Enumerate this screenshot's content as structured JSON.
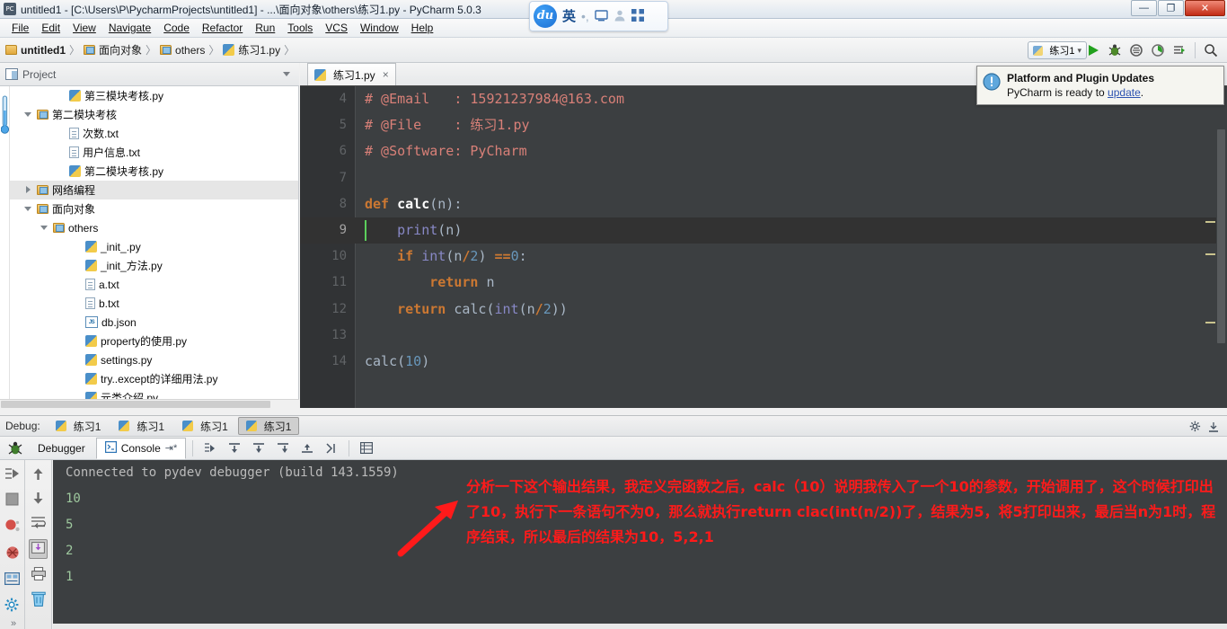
{
  "window": {
    "title": "untitled1 - [C:\\Users\\P\\PycharmProjects\\untitled1] - ...\\面向对象\\others\\练习1.py - PyCharm 5.0.3",
    "app_icon": "pycharm-icon",
    "minimize_label": "—",
    "maximize_label": "❐",
    "close_label": "✕"
  },
  "menu": {
    "items": [
      {
        "label": "File"
      },
      {
        "label": "Edit"
      },
      {
        "label": "View"
      },
      {
        "label": "Navigate"
      },
      {
        "label": "Code"
      },
      {
        "label": "Refactor"
      },
      {
        "label": "Run"
      },
      {
        "label": "Tools"
      },
      {
        "label": "VCS"
      },
      {
        "label": "Window"
      },
      {
        "label": "Help"
      }
    ]
  },
  "ime": {
    "logo": "du",
    "mode": "英",
    "punctuation": "•,",
    "keyboard_icon": "keyboard-icon",
    "user_icon": "user-icon",
    "apps_icon": "apps-grid-icon"
  },
  "breadcrumb": {
    "items": [
      {
        "label": "untitled1",
        "icon": "folder-icon",
        "bold": true
      },
      {
        "label": "面向对象",
        "icon": "module-folder-icon",
        "bold": false
      },
      {
        "label": "others",
        "icon": "module-folder-icon",
        "bold": false
      },
      {
        "label": "练习1.py",
        "icon": "python-file-icon",
        "bold": false
      }
    ],
    "separator": "〉"
  },
  "toolbar": {
    "run_config": "练习1",
    "run_config_caret": "▾",
    "buttons": [
      {
        "name": "run-button",
        "glyph": "▶"
      },
      {
        "name": "debug-button",
        "glyph": "🐞"
      },
      {
        "name": "coverage-button",
        "glyph": "◉"
      },
      {
        "name": "profile-button",
        "glyph": "◔"
      },
      {
        "name": "attach-button",
        "glyph": "☰"
      },
      {
        "name": "search-button",
        "glyph": "🔍"
      }
    ]
  },
  "project_panel": {
    "title": "Project",
    "caret": "▾",
    "tools": [
      {
        "name": "collapse-all-icon",
        "glyph": "⊖"
      },
      {
        "name": "expand-all-icon",
        "glyph": "÷"
      },
      {
        "name": "settings-icon",
        "glyph": "⚙"
      },
      {
        "name": "hide-panel-icon",
        "glyph": "⇥"
      }
    ],
    "tree": [
      {
        "label": "第三模块考核.py",
        "indent": 3,
        "icon": "python-file-icon",
        "twisty": "none",
        "selected": false
      },
      {
        "label": "第二模块考核",
        "indent": 1,
        "icon": "module-folder-icon",
        "twisty": "open",
        "selected": false
      },
      {
        "label": "次数.txt",
        "indent": 3,
        "icon": "text-file-icon",
        "twisty": "none",
        "selected": false
      },
      {
        "label": "用户信息.txt",
        "indent": 3,
        "icon": "text-file-icon",
        "twisty": "none",
        "selected": false
      },
      {
        "label": "第二模块考核.py",
        "indent": 3,
        "icon": "python-file-icon",
        "twisty": "none",
        "selected": false
      },
      {
        "label": "网络编程",
        "indent": 1,
        "icon": "module-folder-icon",
        "twisty": "closed",
        "selected": true
      },
      {
        "label": "面向对象",
        "indent": 1,
        "icon": "module-folder-icon",
        "twisty": "open",
        "selected": false
      },
      {
        "label": "others",
        "indent": 2,
        "icon": "module-folder-icon",
        "twisty": "open",
        "selected": false
      },
      {
        "label": "_init_.py",
        "indent": 4,
        "icon": "python-file-icon",
        "twisty": "none",
        "selected": false
      },
      {
        "label": "_init_方法.py",
        "indent": 4,
        "icon": "python-file-icon",
        "twisty": "none",
        "selected": false
      },
      {
        "label": "a.txt",
        "indent": 4,
        "icon": "text-file-icon",
        "twisty": "none",
        "selected": false
      },
      {
        "label": "b.txt",
        "indent": 4,
        "icon": "text-file-icon",
        "twisty": "none",
        "selected": false
      },
      {
        "label": "db.json",
        "indent": 4,
        "icon": "json-file-icon",
        "twisty": "none",
        "selected": false
      },
      {
        "label": "property的使用.py",
        "indent": 4,
        "icon": "python-file-icon",
        "twisty": "none",
        "selected": false
      },
      {
        "label": "settings.py",
        "indent": 4,
        "icon": "python-file-icon",
        "twisty": "none",
        "selected": false
      },
      {
        "label": "try..except的详细用法.py",
        "indent": 4,
        "icon": "python-file-icon",
        "twisty": "none",
        "selected": false
      },
      {
        "label": "元类介绍.py",
        "indent": 4,
        "icon": "python-file-icon",
        "twisty": "none",
        "selected": false
      }
    ]
  },
  "editor": {
    "tab": {
      "label": "练习1.py",
      "close": "×",
      "icon": "python-file-icon"
    },
    "lines": [
      {
        "num": "4",
        "current": false,
        "tokens": [
          {
            "t": "# @Email   : 15921237984@163.com",
            "c": "tok-com"
          }
        ]
      },
      {
        "num": "5",
        "current": false,
        "tokens": [
          {
            "t": "# @File    : 练习1.py",
            "c": "tok-com"
          }
        ]
      },
      {
        "num": "6",
        "current": false,
        "tokens": [
          {
            "t": "# @Software: PyCharm",
            "c": "tok-com"
          }
        ]
      },
      {
        "num": "7",
        "current": false,
        "tokens": []
      },
      {
        "num": "8",
        "current": false,
        "tokens": [
          {
            "t": "def ",
            "c": "tok-kw"
          },
          {
            "t": "calc",
            "c": "tok-fn"
          },
          {
            "t": "(n):",
            "c": "tok-pl"
          }
        ]
      },
      {
        "num": "9",
        "current": true,
        "tokens": [
          {
            "t": "    ",
            "c": "tok-pl"
          },
          {
            "t": "print",
            "c": "tok-bi"
          },
          {
            "t": "(n)",
            "c": "tok-pl"
          }
        ]
      },
      {
        "num": "10",
        "current": false,
        "tokens": [
          {
            "t": "    ",
            "c": "tok-pl"
          },
          {
            "t": "if ",
            "c": "tok-kw"
          },
          {
            "t": "int",
            "c": "tok-bi"
          },
          {
            "t": "(n",
            "c": "tok-pl"
          },
          {
            "t": "/",
            "c": "tok-kw"
          },
          {
            "t": "2",
            "c": "tok-num"
          },
          {
            "t": ") ",
            "c": "tok-pl"
          },
          {
            "t": "==",
            "c": "tok-kw"
          },
          {
            "t": "0",
            "c": "tok-num"
          },
          {
            "t": ":",
            "c": "tok-pl"
          }
        ]
      },
      {
        "num": "11",
        "current": false,
        "tokens": [
          {
            "t": "        ",
            "c": "tok-pl"
          },
          {
            "t": "return ",
            "c": "tok-kw"
          },
          {
            "t": "n",
            "c": "tok-pl"
          }
        ]
      },
      {
        "num": "12",
        "current": false,
        "tokens": [
          {
            "t": "    ",
            "c": "tok-pl"
          },
          {
            "t": "return ",
            "c": "tok-kw"
          },
          {
            "t": "calc(",
            "c": "tok-pl"
          },
          {
            "t": "int",
            "c": "tok-bi"
          },
          {
            "t": "(n",
            "c": "tok-pl"
          },
          {
            "t": "/",
            "c": "tok-kw"
          },
          {
            "t": "2",
            "c": "tok-num"
          },
          {
            "t": "))",
            "c": "tok-pl"
          }
        ]
      },
      {
        "num": "13",
        "current": false,
        "tokens": []
      },
      {
        "num": "14",
        "current": false,
        "tokens": [
          {
            "t": "calc(",
            "c": "tok-pl"
          },
          {
            "t": "10",
            "c": "tok-num"
          },
          {
            "t": ")",
            "c": "tok-pl"
          }
        ]
      }
    ]
  },
  "notification": {
    "icon": "info-icon",
    "title": "Platform and Plugin Updates",
    "body_prefix": "PyCharm is ready to ",
    "link": "update",
    "body_suffix": "."
  },
  "debug": {
    "label": "Debug:",
    "tabs": [
      {
        "label": "练习1",
        "active": false
      },
      {
        "label": "练习1",
        "active": false
      },
      {
        "label": "练习1",
        "active": false
      },
      {
        "label": "练习1",
        "active": true
      }
    ],
    "settings_icon": "gear-icon",
    "hide_icon": "hide-panel-icon",
    "subtabs": [
      {
        "label": "Debugger",
        "active": false,
        "icon": "debugger-icon"
      },
      {
        "label": "Console",
        "active": true,
        "icon": "console-icon"
      }
    ],
    "step_buttons": [
      {
        "name": "show-execution-point-icon",
        "glyph": "↳"
      },
      {
        "name": "step-over-icon",
        "glyph": "↓"
      },
      {
        "name": "step-into-icon",
        "glyph": "↘"
      },
      {
        "name": "force-step-into-icon",
        "glyph": "↙"
      },
      {
        "name": "step-out-icon",
        "glyph": "↗"
      },
      {
        "name": "run-to-cursor-icon",
        "glyph": "⇥"
      },
      {
        "name": "evaluate-expression-icon",
        "glyph": "▤"
      }
    ],
    "left_tools": [
      {
        "name": "resume-program-icon",
        "glyph": "▶"
      },
      {
        "name": "stop-program-icon",
        "glyph": "■"
      },
      {
        "name": "view-breakpoints-icon",
        "glyph": "●"
      },
      {
        "name": "mute-breakpoints-icon",
        "glyph": "⊘"
      },
      {
        "name": "restore-layout-icon",
        "glyph": "▣"
      },
      {
        "name": "settings-icon",
        "glyph": "⚙"
      }
    ],
    "console_tools": [
      {
        "name": "scroll-up-icon",
        "glyph": "↑"
      },
      {
        "name": "scroll-down-icon",
        "glyph": "↓"
      },
      {
        "name": "soft-wrap-icon",
        "glyph": "↵"
      },
      {
        "name": "scroll-to-end-icon",
        "glyph": "⇲"
      },
      {
        "name": "print-icon",
        "glyph": "⎙"
      },
      {
        "name": "clear-all-icon",
        "glyph": "🗑"
      }
    ],
    "console_output": [
      {
        "text": "Connected to pydev debugger (build 143.1559)",
        "kind": "info"
      },
      {
        "text": "10",
        "kind": "out"
      },
      {
        "text": "5",
        "kind": "out"
      },
      {
        "text": "2",
        "kind": "out"
      },
      {
        "text": "1",
        "kind": "out"
      }
    ]
  },
  "annotation": {
    "color": "#ff1a1a",
    "arrow": "red-arrow-icon",
    "text": "分析一下这个输出结果，我定义完函数之后，calc（10）说明我传入了一个10的参数，开始调用了，这个时候打印出了10，执行下一条语句不为0，那么就执行return clac(int(n/2))了，结果为5，将5打印出来，最后当n为1时，程序结束，所以最后的结果为10，5,2,1"
  },
  "status": {
    "expand_chevron": "»"
  }
}
